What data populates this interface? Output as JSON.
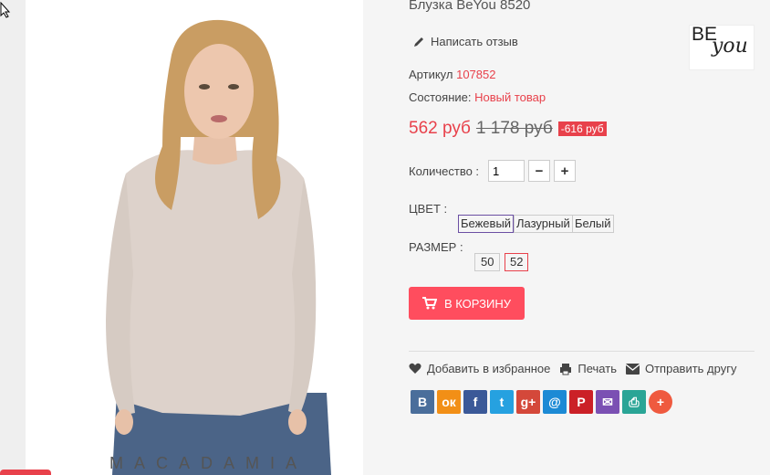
{
  "product": {
    "title": "Блузка BeYou 8520",
    "review_label": "Написать отзыв",
    "brand_text_be": "BE",
    "brand_text_you": "you",
    "article_label": "Артикул",
    "article_value": "107852",
    "condition_label": "Состояние:",
    "condition_value": "Новый товар",
    "price": "562 руб",
    "old_price": "1 178 руб",
    "discount": "-616 руб",
    "watermark": "MACADAMIA"
  },
  "quantity": {
    "label": "Количество :",
    "value": "1",
    "minus": "−",
    "plus": "+"
  },
  "color": {
    "label": "ЦВЕТ :",
    "options": [
      "Бежевый",
      "Лазурный",
      "Белый"
    ],
    "selected": "Бежевый"
  },
  "size": {
    "label": "РАЗМЕР :",
    "options": [
      "50",
      "52"
    ],
    "selected": "52"
  },
  "cart_button": "В КОРЗИНУ",
  "actions": {
    "favorite": "Добавить в избранное",
    "print": "Печать",
    "send": "Отправить другу"
  },
  "social": {
    "buttons": [
      {
        "name": "vk",
        "glyph": "В",
        "color": "#4a6e9b"
      },
      {
        "name": "odnoklassniki",
        "glyph": "ок",
        "color": "#f28f16"
      },
      {
        "name": "facebook",
        "glyph": "f",
        "color": "#3b5998"
      },
      {
        "name": "twitter",
        "glyph": "t",
        "color": "#26a1e0"
      },
      {
        "name": "google-plus",
        "glyph": "g+",
        "color": "#d4483a"
      },
      {
        "name": "mail-ru",
        "glyph": "@",
        "color": "#1c8ad5"
      },
      {
        "name": "pinterest",
        "glyph": "P",
        "color": "#cb2027"
      },
      {
        "name": "email",
        "glyph": "✉",
        "color": "#7b50b3"
      },
      {
        "name": "print",
        "glyph": "⎙",
        "color": "#2aa596"
      },
      {
        "name": "more",
        "glyph": "+",
        "color": "#ef5a3f"
      }
    ]
  }
}
